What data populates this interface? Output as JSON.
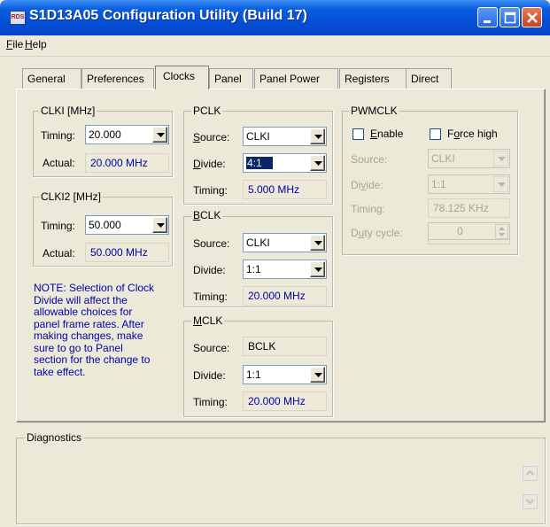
{
  "window": {
    "icon_text": "RDS",
    "title": "S1D13A05 Configuration Utility  (Build 17)"
  },
  "menu": [
    {
      "label": "File",
      "accel": "F",
      "rest": "ile"
    },
    {
      "label": "Help",
      "accel": "H",
      "rest": "elp"
    }
  ],
  "tabs": [
    "General",
    "Preferences",
    "Clocks",
    "Panel",
    "Panel Power",
    "Registers",
    "Direct"
  ],
  "active_tab": "Clocks",
  "clki": {
    "title": "CLKI [MHz]",
    "timing_label": "Timing:",
    "timing_value": "20.000",
    "actual_label": "Actual:",
    "actual_value": "20.000 MHz"
  },
  "clki2": {
    "title": "CLKI2 [MHz]",
    "timing_label": "Timing:",
    "timing_value": "50.000",
    "actual_label": "Actual:",
    "actual_value": "50.000 MHz"
  },
  "note": "NOTE: Selection of Clock Divide will affect the allowable choices for panel frame rates.  After making changes, make sure to go to Panel section for the change to take effect.",
  "note_lines": [
    "NOTE: Selection of Clock",
    "Divide will affect the",
    "allowable choices for",
    "panel frame rates.  After",
    "making changes, make",
    "sure to go to Panel",
    "section for the change to",
    "take effect."
  ],
  "pclk": {
    "title": "PCLK",
    "source_label": "Source:",
    "source_value": "CLKI",
    "divide_label": "Divide:",
    "divide_value": "4:1",
    "timing_label": "Timing:",
    "timing_value": "5.000 MHz"
  },
  "bclk": {
    "title": "BCLK",
    "source_label": "Source:",
    "source_value": "CLKI",
    "divide_label": "Divide:",
    "divide_value": "1:1",
    "timing_label": "Timing:",
    "timing_value": "20.000 MHz"
  },
  "mclk": {
    "title": "MCLK",
    "source_label": "Source:",
    "source_value": "BCLK",
    "divide_label": "Divide:",
    "divide_value": "1:1",
    "timing_label": "Timing:",
    "timing_value": "20.000 MHz"
  },
  "pwmclk": {
    "title": "PWMCLK",
    "enable_label": "Enable",
    "force_high_label": "Force high",
    "source_label": "Source:",
    "source_value": "CLKI",
    "divide_label": "Divide:",
    "divide_value": "1:1",
    "timing_label": "Timing:",
    "timing_value": "78.125 KHz",
    "duty_label": "Duty cycle:",
    "duty_value": "0"
  },
  "diagnostics": {
    "title": "Diagnostics"
  }
}
